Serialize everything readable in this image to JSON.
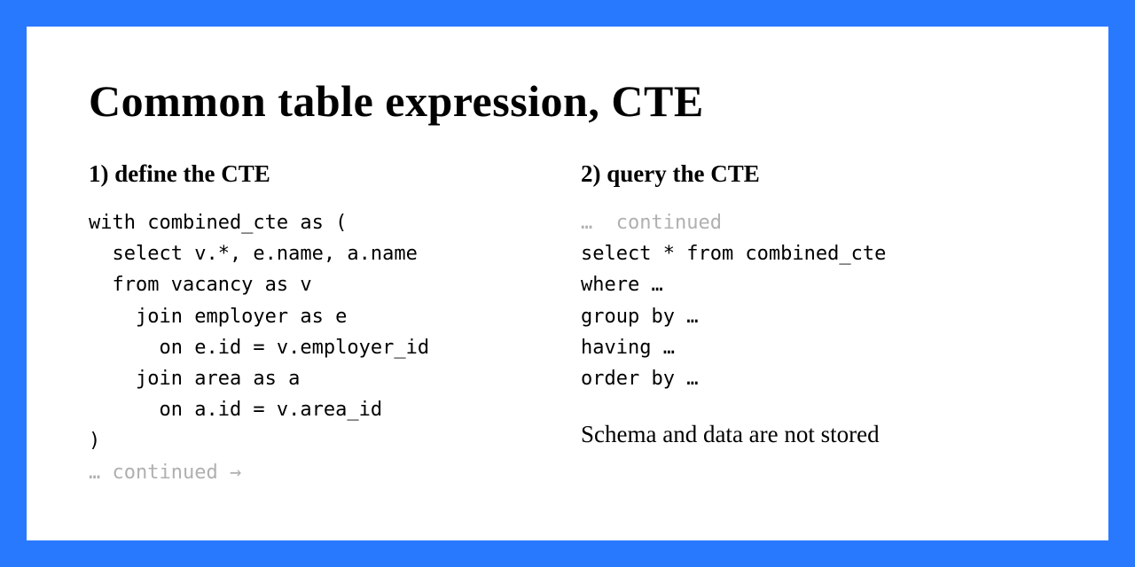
{
  "title": "Common table expression, CTE",
  "left": {
    "heading": "1) define the CTE",
    "code": "with combined_cte as (\n  select v.*, e.name, a.name\n  from vacancy as v\n    join employer as e\n      on e.id = v.employer_id\n    join area as a\n      on a.id = v.area_id\n)",
    "continued": "… continued →"
  },
  "right": {
    "heading": "2) query the CTE",
    "continued": "…  continued",
    "code": "select * from combined_cte\nwhere …\ngroup by …\nhaving …\norder by …",
    "note": "Schema and data are not stored"
  }
}
